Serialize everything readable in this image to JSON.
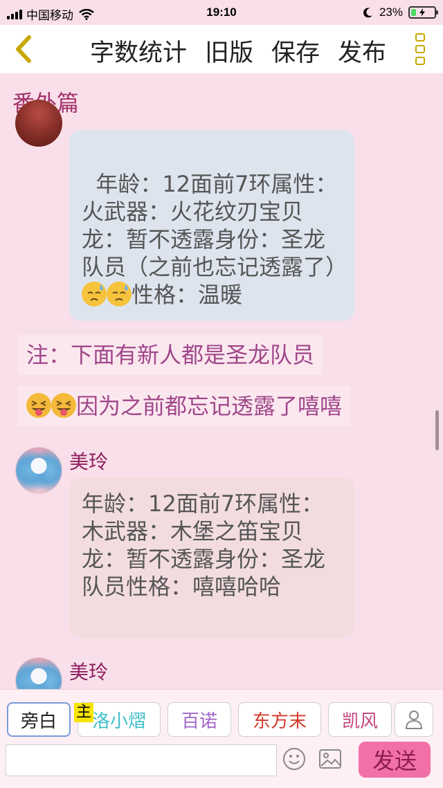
{
  "status_bar": {
    "carrier": "中国移动",
    "time": "19:10",
    "battery": "23%",
    "battery_level": 0.23
  },
  "toolbar": {
    "back_icon": "chevron-left-icon",
    "actions": [
      "字数统计",
      "旧版",
      "保存",
      "发布"
    ],
    "more_icon": "more-vertical-icon"
  },
  "chapter": {
    "title": "番外篇"
  },
  "messages": [
    {
      "avatar": "red-avatar",
      "text": "年龄：12面前7环属性：火武器：火花纹刃宝贝龙：暂不透露身份：圣龙队员（之前也忘记透露了）",
      "suffix": "性格：温暖"
    },
    {
      "note": "注：下面有新人都是圣龙队员"
    },
    {
      "note_emoji": "因为之前都忘记透露了嘻嘻"
    },
    {
      "name": "美玲",
      "text": "年龄：12面前7环属性：木武器：木堡之笛宝贝龙：暂不透露身份：圣龙队员性格：嘻嘻哈哈"
    },
    {
      "name": "美玲"
    }
  ],
  "roles": [
    "旁白",
    "洛小熠",
    "百诺",
    "东方末",
    "凯风"
  ],
  "role_colors": [
    "#222222",
    "#3fbfc9",
    "#a065c8",
    "#d43a2b",
    "#c4437b"
  ],
  "role_tag": "主",
  "input": {
    "placeholder": "",
    "send_label": "发送"
  },
  "colors": {
    "accent": "#f270a8",
    "title": "#a2326b",
    "note_text": "#a0478a"
  }
}
